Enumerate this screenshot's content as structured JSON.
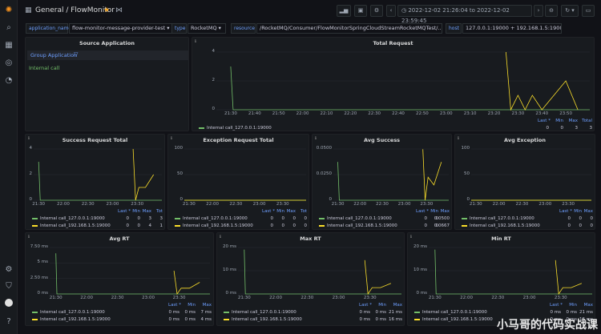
{
  "nav": {
    "breadcrumb": "General / FlowMonitor",
    "time_range": "2022-12-02 21:26:04 to 2022-12-02 23:59:45"
  },
  "variables": [
    {
      "label": "application_name",
      "value": "flow-monitor-message-provider-test"
    },
    {
      "label": "type",
      "value": "RocketMQ"
    },
    {
      "label": "resource",
      "value": "/RocketMQ/Consumer/FlowMonitorSpringCloudStreamRocketMQTest/..."
    },
    {
      "label": "host",
      "value": "127.0.0.1:19000 + 192.168.1.5:19000"
    }
  ],
  "colors": {
    "green": "#73bf69",
    "yellow": "#fade2a",
    "grid": "#2a2d33",
    "accent": "#6e9fff"
  },
  "source_panel": {
    "title": "Source Application",
    "header": "Group Application",
    "item": "Internal call"
  },
  "legend_labels": {
    "last": "Last *",
    "min": "Min",
    "max": "Max",
    "total": "Total",
    "tot": "Tot"
  },
  "series_names": [
    "Internal call_127.0.0.1:19000",
    "Internal call_192.168.1.5:19000"
  ],
  "panels": {
    "total_request": {
      "title": "Total Request",
      "yticks": [
        "4",
        "2",
        "0"
      ],
      "xticks": [
        "21:30",
        "21:40",
        "21:50",
        "22:00",
        "22:10",
        "22:20",
        "22:30",
        "22:40",
        "22:50",
        "23:00",
        "23:10",
        "23:20",
        "23:30",
        "23:40",
        "23:50"
      ],
      "rows": [
        [
          "0",
          "0",
          "3",
          "3"
        ],
        [
          "0",
          "0",
          "4",
          "15"
        ]
      ]
    },
    "success_request_total": {
      "title": "Success Request Total",
      "yticks": [
        "4",
        "2",
        "0"
      ],
      "xticks": [
        "21:30",
        "22:00",
        "22:30",
        "23:00",
        "23:30"
      ],
      "rows": [
        [
          "0",
          "0",
          "3",
          "3"
        ],
        [
          "0",
          "0",
          "4",
          "1"
        ]
      ]
    },
    "exception_request_total": {
      "title": "Exception Request Total",
      "yticks": [
        "100",
        "50",
        "0"
      ],
      "xticks": [
        "21:30",
        "22:00",
        "22:30",
        "23:00",
        "23:30"
      ],
      "rows": [
        [
          "0",
          "0",
          "0",
          "0"
        ],
        [
          "0",
          "0",
          "0",
          "0"
        ]
      ]
    },
    "avg_success": {
      "title": "Avg Success",
      "yticks": [
        "0.0500",
        "0.0250",
        "0"
      ],
      "xticks": [
        "21:30",
        "22:00",
        "22:30",
        "23:00",
        "23:30"
      ],
      "rows": [
        [
          "0",
          "0",
          "0.0500"
        ],
        [
          "0",
          "0",
          "0.0667"
        ]
      ]
    },
    "avg_exception": {
      "title": "Avg Exception",
      "yticks": [
        "100",
        "50",
        "0"
      ],
      "xticks": [
        "21:30",
        "22:00",
        "22:30",
        "23:00",
        "23:30"
      ],
      "rows": [
        [
          "0",
          "0",
          "0"
        ],
        [
          "0",
          "0",
          "0"
        ]
      ]
    },
    "avg_rt": {
      "title": "Avg RT",
      "yticks": [
        "7.50 ms",
        "5 ms",
        "2.50 ms",
        "0 ms"
      ],
      "xticks": [
        "21:30",
        "22:00",
        "22:30",
        "23:00",
        "23:30"
      ],
      "rows": [
        [
          "0 ms",
          "0 ms",
          "7 ms"
        ],
        [
          "0 ms",
          "0 ms",
          "4 ms"
        ]
      ]
    },
    "max_rt": {
      "title": "Max RT",
      "yticks": [
        "20 ms",
        "10 ms",
        "0 ms"
      ],
      "xticks": [
        "21:30",
        "22:00",
        "22:30",
        "23:00",
        "23:30"
      ],
      "rows": [
        [
          "0 ms",
          "0 ms",
          "21 ms"
        ],
        [
          "0 ms",
          "0 ms",
          "16 ms"
        ]
      ]
    },
    "min_rt": {
      "title": "Min RT",
      "yticks": [
        "20 ms",
        "10 ms",
        "0 ms"
      ],
      "xticks": [
        "21:30",
        "22:00",
        "22:30",
        "23:00",
        "23:30"
      ],
      "rows": [
        [
          "0 ms",
          "0 ms",
          "21 ms"
        ],
        [
          "0 ms",
          "0 ms",
          "16 ms"
        ]
      ]
    }
  },
  "chart_data": [
    {
      "type": "line",
      "title": "Total Request",
      "series": [
        {
          "name": "Internal call_127.0.0.1:19000",
          "x": [
            "21:30",
            "21:31",
            "21:32",
            "23:40",
            "23:50"
          ],
          "values": [
            3,
            0,
            0,
            0,
            0
          ]
        },
        {
          "name": "Internal call_192.168.1.5:19000",
          "x": [
            "23:25",
            "23:27",
            "23:30",
            "23:33",
            "23:36",
            "23:40",
            "23:45",
            "23:50",
            "23:55"
          ],
          "values": [
            4,
            0,
            1,
            0,
            1,
            0,
            1,
            2,
            0
          ]
        }
      ],
      "ylim": [
        0,
        4
      ]
    },
    {
      "type": "line",
      "title": "Success Request Total",
      "series": [
        {
          "name": "Internal call_127.0.0.1:19000",
          "x": [
            "21:30",
            "21:32",
            "23:59"
          ],
          "values": [
            3,
            0,
            0
          ]
        },
        {
          "name": "Internal call_192.168.1.5:19000",
          "x": [
            "23:25",
            "23:28",
            "23:32",
            "23:40",
            "23:50"
          ],
          "values": [
            4,
            0,
            1,
            1,
            2
          ]
        }
      ],
      "ylim": [
        0,
        4
      ]
    },
    {
      "type": "line",
      "title": "Exception Request Total",
      "series": [
        {
          "name": "Internal call_127.0.0.1:19000",
          "values": [
            0,
            0,
            0
          ]
        },
        {
          "name": "Internal call_192.168.1.5:19000",
          "values": [
            0,
            0,
            0
          ]
        }
      ],
      "ylim": [
        0,
        100
      ]
    },
    {
      "type": "line",
      "title": "Avg Success",
      "series": [
        {
          "name": "Internal call_127.0.0.1:19000",
          "x": [
            "21:30",
            "21:32"
          ],
          "values": [
            0.05,
            0
          ]
        },
        {
          "name": "Internal call_192.168.1.5:19000",
          "x": [
            "23:25",
            "23:28",
            "23:32",
            "23:40",
            "23:50"
          ],
          "values": [
            0.0667,
            0,
            0.03,
            0.02,
            0.05
          ]
        }
      ],
      "ylim": [
        0,
        0.067
      ]
    },
    {
      "type": "line",
      "title": "Avg Exception",
      "series": [
        {
          "name": "Internal call_127.0.0.1:19000",
          "values": [
            0,
            0,
            0
          ]
        },
        {
          "name": "Internal call_192.168.1.5:19000",
          "values": [
            0,
            0,
            0
          ]
        }
      ],
      "ylim": [
        0,
        100
      ]
    },
    {
      "type": "line",
      "title": "Avg RT",
      "series": [
        {
          "name": "Internal call_127.0.0.1:19000",
          "x": [
            "21:30",
            "21:31"
          ],
          "values": [
            7,
            0
          ]
        },
        {
          "name": "Internal call_192.168.1.5:19000",
          "x": [
            "23:25",
            "23:28",
            "23:32",
            "23:40",
            "23:50"
          ],
          "values": [
            4,
            0,
            1,
            1,
            2
          ]
        }
      ],
      "ylim": [
        0,
        8
      ]
    },
    {
      "type": "line",
      "title": "Max RT",
      "series": [
        {
          "name": "Internal call_127.0.0.1:19000",
          "x": [
            "21:30",
            "21:31"
          ],
          "values": [
            21,
            0
          ]
        },
        {
          "name": "Internal call_192.168.1.5:19000",
          "x": [
            "23:25",
            "23:28",
            "23:32",
            "23:40",
            "23:50"
          ],
          "values": [
            16,
            0,
            3,
            3,
            5
          ]
        }
      ],
      "ylim": [
        0,
        22
      ]
    },
    {
      "type": "line",
      "title": "Min RT",
      "series": [
        {
          "name": "Internal call_127.0.0.1:19000",
          "x": [
            "21:30",
            "21:31"
          ],
          "values": [
            21,
            0
          ]
        },
        {
          "name": "Internal call_192.168.1.5:19000",
          "x": [
            "23:25",
            "23:28",
            "23:32",
            "23:40",
            "23:50"
          ],
          "values": [
            16,
            0,
            3,
            3,
            5
          ]
        }
      ],
      "ylim": [
        0,
        22
      ]
    }
  ],
  "watermark": "小马哥的代码实战课"
}
